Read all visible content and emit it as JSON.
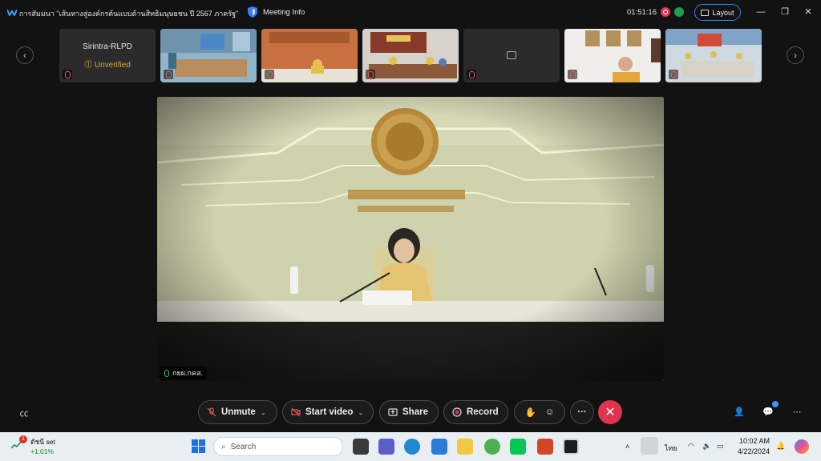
{
  "window": {
    "title": "การสัมมนา \"เส้นทางสู่องค์กรต้นแบบด้านสิทธิมนุษยชน ปี 2567 ภาครัฐ\"",
    "meeting_info_label": "Meeting Info",
    "timer": "01:51:16",
    "layout_label": "Layout",
    "minimize": "—",
    "restore": "❐",
    "close": "✕"
  },
  "participants": [
    {
      "name": "Sirintra-RLPD",
      "status": "Unverified",
      "kind": "avatar"
    },
    {
      "name": "",
      "status": "",
      "kind": "video-office"
    },
    {
      "name": "",
      "status": "",
      "kind": "video-room-orange"
    },
    {
      "name": "",
      "status": "",
      "kind": "video-meeting-table"
    },
    {
      "name": "",
      "status": "",
      "kind": "camera-off"
    },
    {
      "name": "",
      "status": "",
      "kind": "video-man"
    },
    {
      "name": "",
      "status": "",
      "kind": "video-group"
    }
  ],
  "main_video": {
    "speaker_label": "กยผ.กคส."
  },
  "controls": {
    "unmute": "Unmute",
    "start_video": "Start video",
    "share": "Share",
    "record": "Record",
    "more": "···",
    "end": "✕"
  },
  "taskbar": {
    "stock_name": "ดัชนี set",
    "stock_change": "+1.01%",
    "stock_badge": "1",
    "search_placeholder": "Search",
    "lang": "ไทย",
    "time": "10:02 AM",
    "date": "4/22/2024"
  },
  "colors": {
    "accent": "#3d7cf0",
    "end_call": "#e0334f",
    "warning": "#e0a13b"
  }
}
